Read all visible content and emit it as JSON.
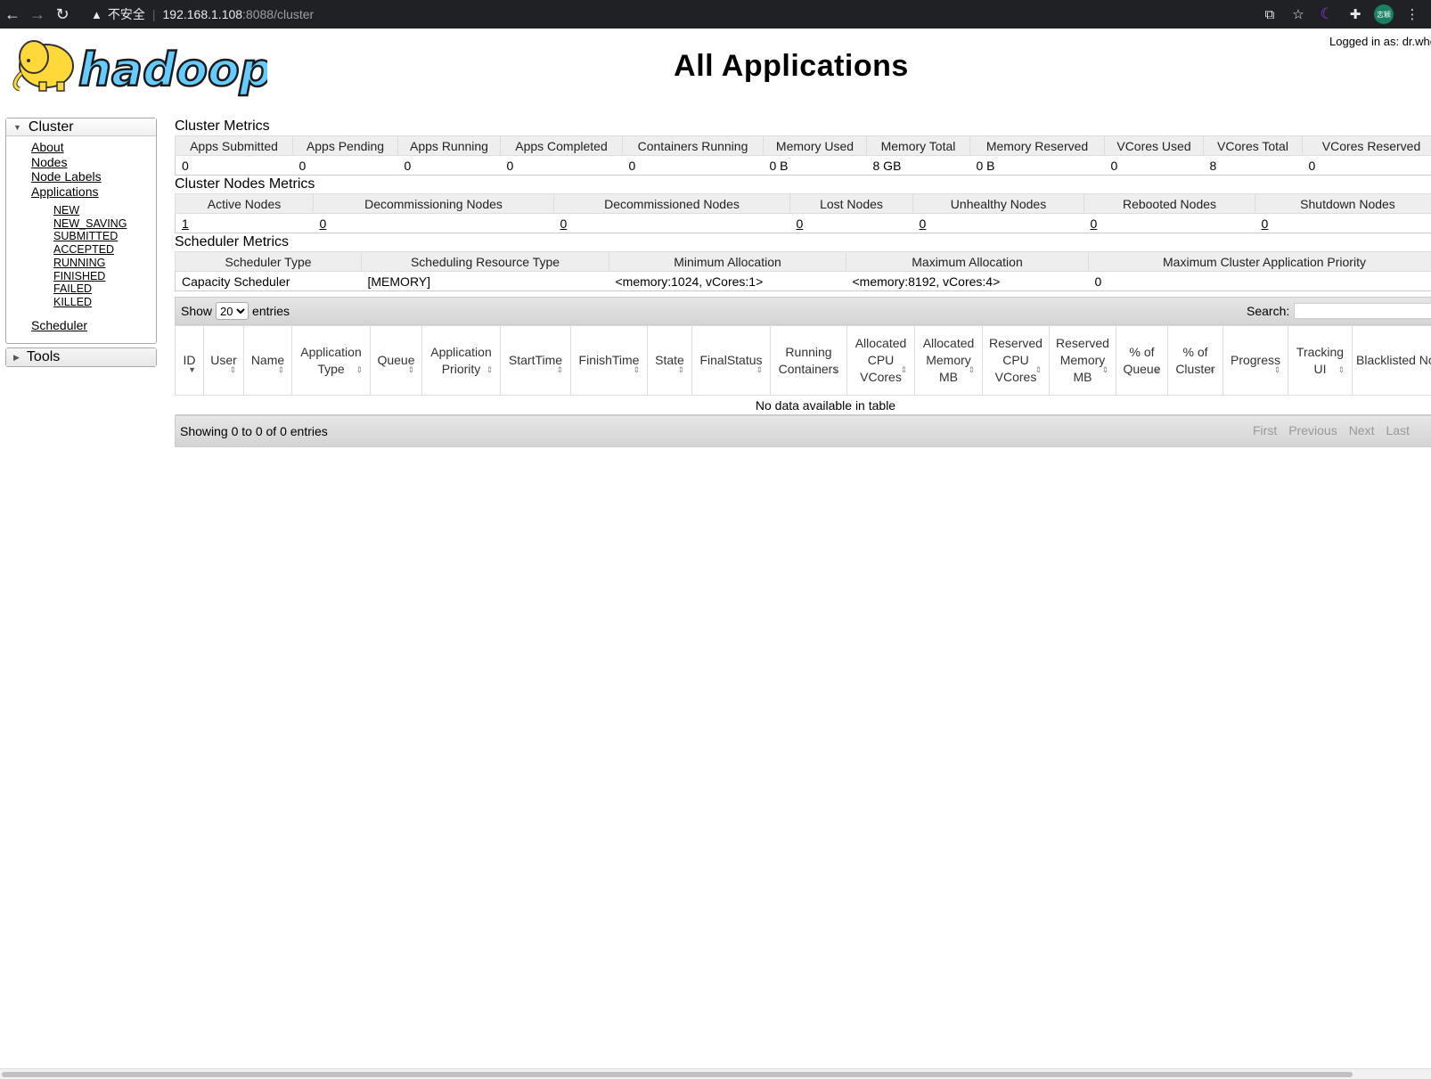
{
  "browser": {
    "back_icon": "←",
    "forward_icon": "→",
    "reload_icon": "↻",
    "warning_icon": "▲",
    "insecure_label": "不安全",
    "url_host": "192.168.1.108",
    "url_path": ":8088/cluster",
    "translate_icon": "⧉",
    "star_icon": "☆",
    "moon_icon": "☾",
    "extensions_icon": "✚",
    "profile_label": "志颖",
    "menu_icon": "⋮"
  },
  "header": {
    "logged_in": "Logged in as: dr.who",
    "title": "All Applications",
    "logo_text": "hadoop"
  },
  "sidebar": {
    "cluster_label": "Cluster",
    "links": [
      "About",
      "Nodes",
      "Node Labels",
      "Applications"
    ],
    "app_states": [
      "NEW",
      "NEW_SAVING",
      "SUBMITTED",
      "ACCEPTED",
      "RUNNING",
      "FINISHED",
      "FAILED",
      "KILLED"
    ],
    "scheduler_label": "Scheduler",
    "tools_label": "Tools"
  },
  "cluster_metrics": {
    "title": "Cluster Metrics",
    "headers": [
      "Apps Submitted",
      "Apps Pending",
      "Apps Running",
      "Apps Completed",
      "Containers Running",
      "Memory Used",
      "Memory Total",
      "Memory Reserved",
      "VCores Used",
      "VCores Total",
      "VCores Reserved"
    ],
    "values": [
      "0",
      "0",
      "0",
      "0",
      "0",
      "0 B",
      "8 GB",
      "0 B",
      "0",
      "8",
      "0"
    ]
  },
  "nodes_metrics": {
    "title": "Cluster Nodes Metrics",
    "headers": [
      "Active Nodes",
      "Decommissioning Nodes",
      "Decommissioned Nodes",
      "Lost Nodes",
      "Unhealthy Nodes",
      "Rebooted Nodes",
      "Shutdown Nodes"
    ],
    "values": [
      "1",
      "0",
      "0",
      "0",
      "0",
      "0",
      "0"
    ]
  },
  "scheduler_metrics": {
    "title": "Scheduler Metrics",
    "headers": [
      "Scheduler Type",
      "Scheduling Resource Type",
      "Minimum Allocation",
      "Maximum Allocation",
      "Maximum Cluster Application Priority"
    ],
    "values": [
      "Capacity Scheduler",
      "[MEMORY]",
      "<memory:1024, vCores:1>",
      "<memory:8192, vCores:4>",
      "0"
    ]
  },
  "apps_table": {
    "show_label": "Show",
    "page_size": "20",
    "entries_label": "entries",
    "search_label": "Search:",
    "columns": [
      "ID",
      "User",
      "Name",
      "Application Type",
      "Queue",
      "Application Priority",
      "StartTime",
      "FinishTime",
      "State",
      "FinalStatus",
      "Running Containers",
      "Allocated CPU VCores",
      "Allocated Memory MB",
      "Reserved CPU VCores",
      "Reserved Memory MB",
      "% of Queue",
      "% of Cluster",
      "Progress",
      "Tracking UI",
      "Blacklisted Nodes"
    ],
    "empty_message": "No data available in table",
    "info": "Showing 0 to 0 of 0 entries",
    "pager": [
      "First",
      "Previous",
      "Next",
      "Last"
    ]
  }
}
